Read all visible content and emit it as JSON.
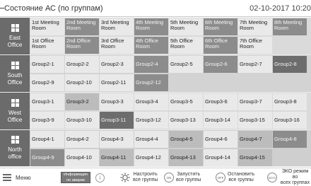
{
  "header": {
    "title": "Состояние АС (по группам)",
    "datetime": "02-10-2017  10:20"
  },
  "offices": [
    {
      "name_line1": "East",
      "name_line2": "Office",
      "row1": [
        {
          "label": "1st Meeting Room",
          "shade": "light"
        },
        {
          "label": "2nd Meeting Room",
          "shade": "dark"
        },
        {
          "label": "3rd Meeting Room",
          "shade": "light"
        },
        {
          "label": "4th Meeting Room",
          "shade": "dark"
        },
        {
          "label": "5th Meeting Room",
          "shade": "light"
        },
        {
          "label": "6th Meeting Room",
          "shade": "dark"
        },
        {
          "label": "7th Meeting Room",
          "shade": "light"
        },
        {
          "label": "8th Meeting Room",
          "shade": "dark"
        }
      ],
      "row2": [
        {
          "label": "1st Office Room",
          "shade": "light"
        },
        {
          "label": "2nd Office Room",
          "shade": "dark"
        },
        {
          "label": "3rd Office Room",
          "shade": "light"
        },
        {
          "label": "4th Office Room",
          "shade": "dark"
        },
        {
          "label": "5th Office Room",
          "shade": "light"
        },
        {
          "label": "6th Office Room",
          "shade": "dark"
        },
        {
          "label": "7th Office Room",
          "shade": "light"
        }
      ]
    },
    {
      "name_line1": "South",
      "name_line2": "Office",
      "row1": [
        {
          "label": "Group2-1",
          "shade": "light"
        },
        {
          "label": "Group2-2",
          "shade": "light"
        },
        {
          "label": "Group2-3",
          "shade": "light"
        },
        {
          "label": "Group2-4",
          "shade": "dark"
        },
        {
          "label": "Group2-5",
          "shade": "light"
        },
        {
          "label": "Group2-6",
          "shade": "dark"
        },
        {
          "label": "Group2-7",
          "shade": "light"
        },
        {
          "label": "Group2-8",
          "shade": "darker"
        }
      ],
      "row2": [
        {
          "label": "Group2-9",
          "shade": "light"
        },
        {
          "label": "Group2-10",
          "shade": "light"
        },
        {
          "label": "Group2-11",
          "shade": "light"
        },
        {
          "label": "Group2-12",
          "shade": "dark"
        }
      ]
    },
    {
      "name_line1": "West",
      "name_line2": "Office",
      "row1": [
        {
          "label": "Group3-1",
          "shade": "light"
        },
        {
          "label": "Group3-2",
          "shade": "mid"
        },
        {
          "label": "Group3-3",
          "shade": "light"
        },
        {
          "label": "Group3-4",
          "shade": "light"
        },
        {
          "label": "Group3-5",
          "shade": "light"
        },
        {
          "label": "Group3-6",
          "shade": "light"
        },
        {
          "label": "Group3-7",
          "shade": "light"
        },
        {
          "label": "Group3-8",
          "shade": "light"
        }
      ],
      "row2": [
        {
          "label": "Group3-9",
          "shade": "light"
        },
        {
          "label": "Group3-10",
          "shade": "light"
        },
        {
          "label": "Group3-11",
          "shade": "darker"
        },
        {
          "label": "Group3-12",
          "shade": "light"
        },
        {
          "label": "Group3-13",
          "shade": "light"
        },
        {
          "label": "Group3-14",
          "shade": "light"
        },
        {
          "label": "Group3-15",
          "shade": "light"
        },
        {
          "label": "Group3-16",
          "shade": "light"
        }
      ]
    },
    {
      "name_line1": "North",
      "name_line2": "office",
      "row1": [
        {
          "label": "Group4-1",
          "shade": "light"
        },
        {
          "label": "Group4-2",
          "shade": "light"
        },
        {
          "label": "Group4-3",
          "shade": "light"
        },
        {
          "label": "Group4-4",
          "shade": "light"
        },
        {
          "label": "Group4-5",
          "shade": "mid"
        },
        {
          "label": "Group4-6",
          "shade": "light"
        },
        {
          "label": "Group4-7",
          "shade": "mid"
        },
        {
          "label": "Group4-8",
          "shade": "dark"
        }
      ],
      "row2": [
        {
          "label": "Group4-9",
          "shade": "dark"
        },
        {
          "label": "Group4-10",
          "shade": "light"
        },
        {
          "label": "Group4-11",
          "shade": "mid"
        },
        {
          "label": "Group4-12",
          "shade": "light"
        },
        {
          "label": "Group4-13",
          "shade": "mid"
        },
        {
          "label": "Group4-14",
          "shade": "light"
        },
        {
          "label": "Group4-15",
          "shade": "mid"
        }
      ]
    }
  ],
  "footer": {
    "menu_label": "Меню",
    "info_button_line1": "Информация",
    "info_button_line2": "по аварии",
    "info_icon": "i",
    "configure_line1": "Настроить",
    "configure_line2": "все группы",
    "start_badge": "ON",
    "start_line1": "Запустить",
    "start_line2": "все группы",
    "stop_badge": "OFF",
    "stop_line1": "Остановить",
    "stop_line2": "все группы",
    "eco_badge": "ECO",
    "eco_line1": "ЭКО режим во",
    "eco_line2": "всех группах"
  }
}
